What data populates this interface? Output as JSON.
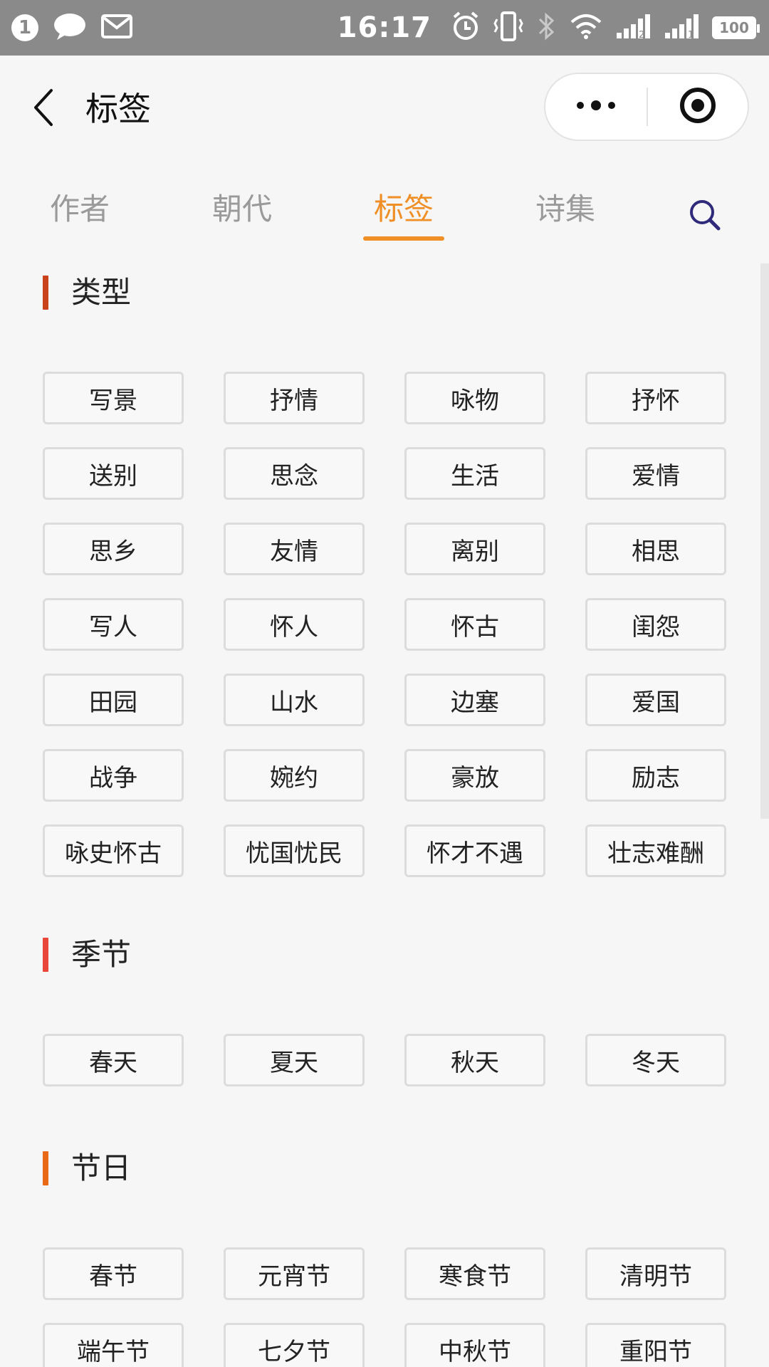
{
  "status_bar": {
    "badge": "1",
    "time": "16:17",
    "battery": "100",
    "icons": [
      "chat-icon",
      "mail-icon",
      "alarm-icon",
      "vibrate-icon",
      "bluetooth-icon",
      "wifi-icon",
      "signal-sim2-icon",
      "signal-sim1-icon"
    ]
  },
  "header": {
    "title": "标签",
    "back_icon": "back-chevron-icon",
    "more_icon": "more-dots-icon",
    "close_icon": "target-close-icon"
  },
  "tabs": {
    "items": [
      {
        "label": "作者"
      },
      {
        "label": "朝代"
      },
      {
        "label": "标签"
      },
      {
        "label": "诗集"
      }
    ],
    "active_index": 2,
    "search_icon": "search-icon"
  },
  "colors": {
    "accent": "#ef8f25",
    "section_type_bar": "#c8431a",
    "section_season_bar": "#e8473a",
    "section_festival_bar": "#e86a16",
    "search_icon": "#2f2a7a"
  },
  "sections": [
    {
      "title": "类型",
      "tags": [
        "写景",
        "抒情",
        "咏物",
        "抒怀",
        "送别",
        "思念",
        "生活",
        "爱情",
        "思乡",
        "友情",
        "离别",
        "相思",
        "写人",
        "怀人",
        "怀古",
        "闺怨",
        "田园",
        "山水",
        "边塞",
        "爱国",
        "战争",
        "婉约",
        "豪放",
        "励志",
        "咏史怀古",
        "忧国忧民",
        "怀才不遇",
        "壮志难酬"
      ]
    },
    {
      "title": "季节",
      "tags": [
        "春天",
        "夏天",
        "秋天",
        "冬天"
      ]
    },
    {
      "title": "节日",
      "tags": [
        "春节",
        "元宵节",
        "寒食节",
        "清明节",
        "端午节",
        "七夕节",
        "中秋节",
        "重阳节"
      ]
    }
  ]
}
